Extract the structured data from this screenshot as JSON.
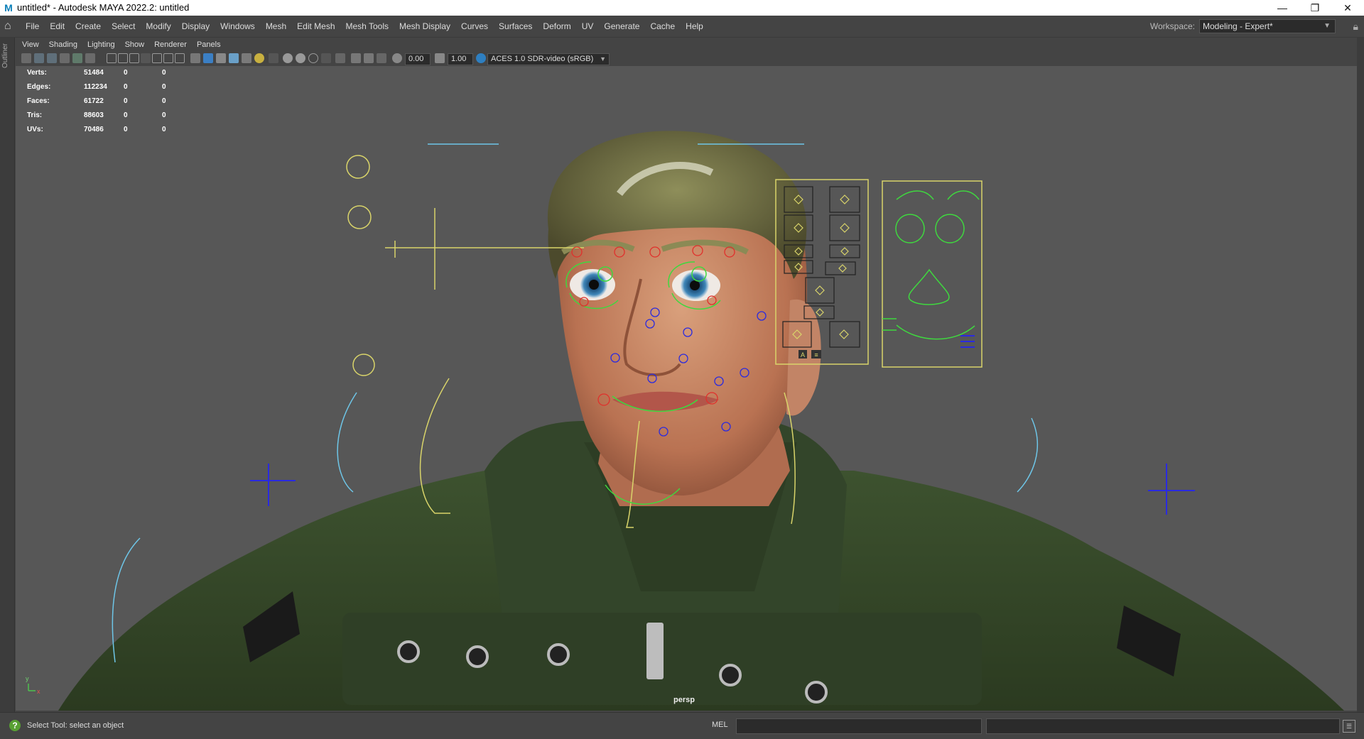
{
  "window": {
    "title": "untitled* - Autodesk MAYA 2022.2: untitled",
    "app_icon": "M",
    "min": "—",
    "restore": "❐",
    "close": "✕"
  },
  "menubar": {
    "items": [
      "File",
      "Edit",
      "Create",
      "Select",
      "Modify",
      "Display",
      "Windows",
      "Mesh",
      "Edit Mesh",
      "Mesh Tools",
      "Mesh Display",
      "Curves",
      "Surfaces",
      "Deform",
      "UV",
      "Generate",
      "Cache",
      "Help"
    ],
    "workspace_label": "Workspace:",
    "workspace_value": "Modeling - Expert*"
  },
  "side_panel": {
    "label": "Outliner"
  },
  "panel_menu": {
    "items": [
      "View",
      "Shading",
      "Lighting",
      "Show",
      "Renderer",
      "Panels"
    ]
  },
  "toolbar": {
    "exposure": "0.00",
    "gamma": "1.00",
    "color_space": "ACES 1.0 SDR-video (sRGB)"
  },
  "hud": {
    "rows": [
      {
        "label": "Verts:",
        "value": "51484",
        "sel": "0",
        "comp": "0"
      },
      {
        "label": "Edges:",
        "value": "112234",
        "sel": "0",
        "comp": "0"
      },
      {
        "label": "Faces:",
        "value": "61722",
        "sel": "0",
        "comp": "0"
      },
      {
        "label": "Tris:",
        "value": "88603",
        "sel": "0",
        "comp": "0"
      },
      {
        "label": "UVs:",
        "value": "70486",
        "sel": "0",
        "comp": "0"
      }
    ]
  },
  "viewport": {
    "camera": "persp",
    "axis_y": "y",
    "axis_x": "x",
    "gui_buttons": [
      "A",
      "≡"
    ],
    "colors": {
      "bg": "#575757",
      "ctrl_yellow": "#d9d46a",
      "ctrl_green": "#3fd83f",
      "ctrl_red": "#e0302c",
      "ctrl_blue": "#2a2ae0",
      "ctrl_cyan": "#6ec6e8",
      "jacket": "#36482a",
      "skin": "#c98a68"
    }
  },
  "status": {
    "message": "Select Tool: select an object",
    "cmd_lang": "MEL",
    "help_icon": "?",
    "script_editor_icon": "☰"
  }
}
